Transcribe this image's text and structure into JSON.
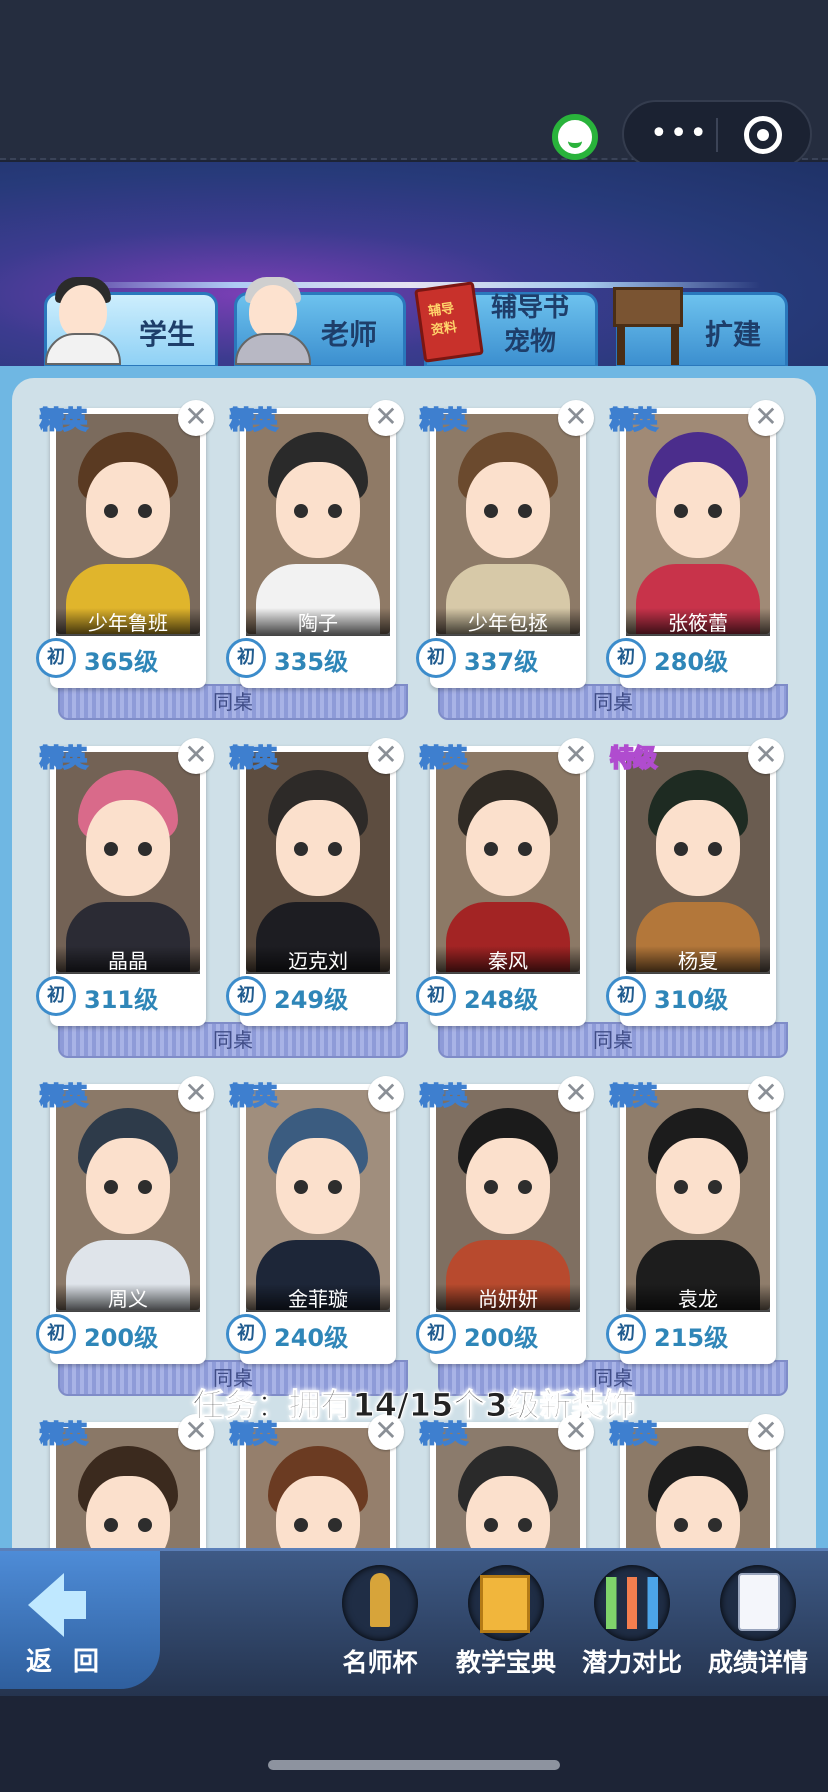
{
  "colors": {
    "accent": "#3c8ccb",
    "panel": "#cfe0e8",
    "elite": "#3e7fcf",
    "special": "#b04ccf"
  },
  "tabs": [
    {
      "label": "学生",
      "active": true
    },
    {
      "label": "老师",
      "active": false
    },
    {
      "label": "辅导书\n宠物",
      "active": false
    },
    {
      "label": "扩建",
      "active": false
    }
  ],
  "cards": [
    {
      "badge": "精英",
      "name": "少年鲁班",
      "grade": "初",
      "level": "365级"
    },
    {
      "badge": "精英",
      "name": "陶子",
      "grade": "初",
      "level": "335级"
    },
    {
      "badge": "精英",
      "name": "少年包拯",
      "grade": "初",
      "level": "337级"
    },
    {
      "badge": "精英",
      "name": "张筱蕾",
      "grade": "初",
      "level": "280级"
    },
    {
      "badge": "精英",
      "name": "晶晶",
      "grade": "初",
      "level": "311级"
    },
    {
      "badge": "精英",
      "name": "迈克刘",
      "grade": "初",
      "level": "249级"
    },
    {
      "badge": "精英",
      "name": "秦风",
      "grade": "初",
      "level": "248级"
    },
    {
      "badge": "特级",
      "name": "杨夏",
      "grade": "初",
      "level": "310级"
    },
    {
      "badge": "精英",
      "name": "周义",
      "grade": "初",
      "level": "200级"
    },
    {
      "badge": "精英",
      "name": "金菲璇",
      "grade": "初",
      "level": "240级"
    },
    {
      "badge": "精英",
      "name": "尚妍妍",
      "grade": "初",
      "level": "200级"
    },
    {
      "badge": "精英",
      "name": "袁龙",
      "grade": "初",
      "level": "215级"
    },
    {
      "badge": "精英"
    },
    {
      "badge": "精英"
    },
    {
      "badge": "精英"
    },
    {
      "badge": "精英"
    }
  ],
  "desk_label": "同桌",
  "task": "任务：拥有14/15个3级新装饰",
  "bottom": {
    "back": "返 回",
    "buttons": [
      "名师杯",
      "教学宝典",
      "潜力对比",
      "成绩详情"
    ]
  },
  "icons": [
    "wechat-icon",
    "more-icon",
    "close-miniprogram-icon",
    "remove-icon",
    "back-arrow-icon",
    "trophy-icon",
    "book-icon",
    "chart-icon",
    "report-icon"
  ]
}
